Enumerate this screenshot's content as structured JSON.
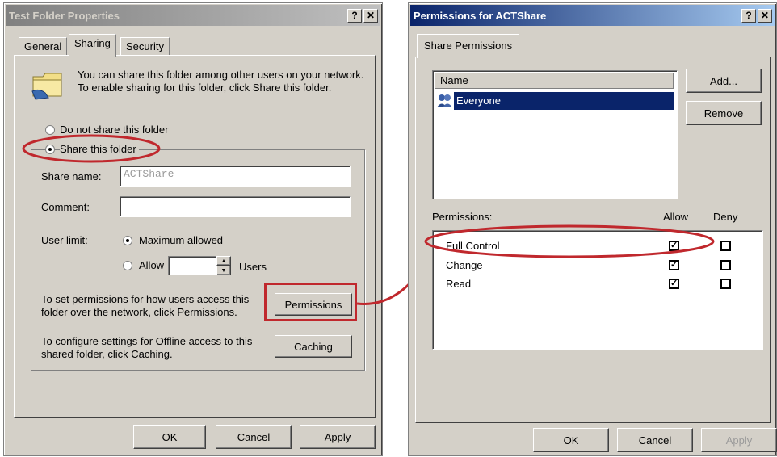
{
  "left_dialog": {
    "title": "Test Folder Properties",
    "help_btn": "?",
    "close_btn": "✕",
    "tabs": [
      "General",
      "Sharing",
      "Security"
    ],
    "intro": "You can share this folder among other users on your network.  To enable sharing for this folder, click Share this folder.",
    "radio_no_share": "Do not share this folder",
    "radio_share": "Share this folder",
    "share_name_label": "Share name:",
    "share_name_value": "ACTShare",
    "comment_label": "Comment:",
    "comment_value": "",
    "user_limit_label": "User limit:",
    "max_allowed": "Maximum allowed",
    "allow": "Allow",
    "users": "Users",
    "permissions_text": "To set permissions for how users access this folder over the network, click Permissions.",
    "permissions_btn": "Permissions",
    "caching_text": "To configure settings for Offline access to this shared folder, click Caching.",
    "caching_btn": "Caching",
    "ok": "OK",
    "cancel": "Cancel",
    "apply": "Apply"
  },
  "right_dialog": {
    "title": "Permissions for ACTShare",
    "help_btn": "?",
    "close_btn": "✕",
    "tab": "Share Permissions",
    "name_header": "Name",
    "names": [
      "Everyone"
    ],
    "add_btn": "Add...",
    "remove_btn": "Remove",
    "permissions_label": "Permissions:",
    "allow_header": "Allow",
    "deny_header": "Deny",
    "permissions": [
      {
        "name": "Full Control",
        "allow": true,
        "deny": false
      },
      {
        "name": "Change",
        "allow": true,
        "deny": false
      },
      {
        "name": "Read",
        "allow": true,
        "deny": false
      }
    ],
    "ok": "OK",
    "cancel": "Cancel",
    "apply": "Apply"
  },
  "colors": {
    "highlight": "#c0282d",
    "selection": "#0a246a"
  }
}
